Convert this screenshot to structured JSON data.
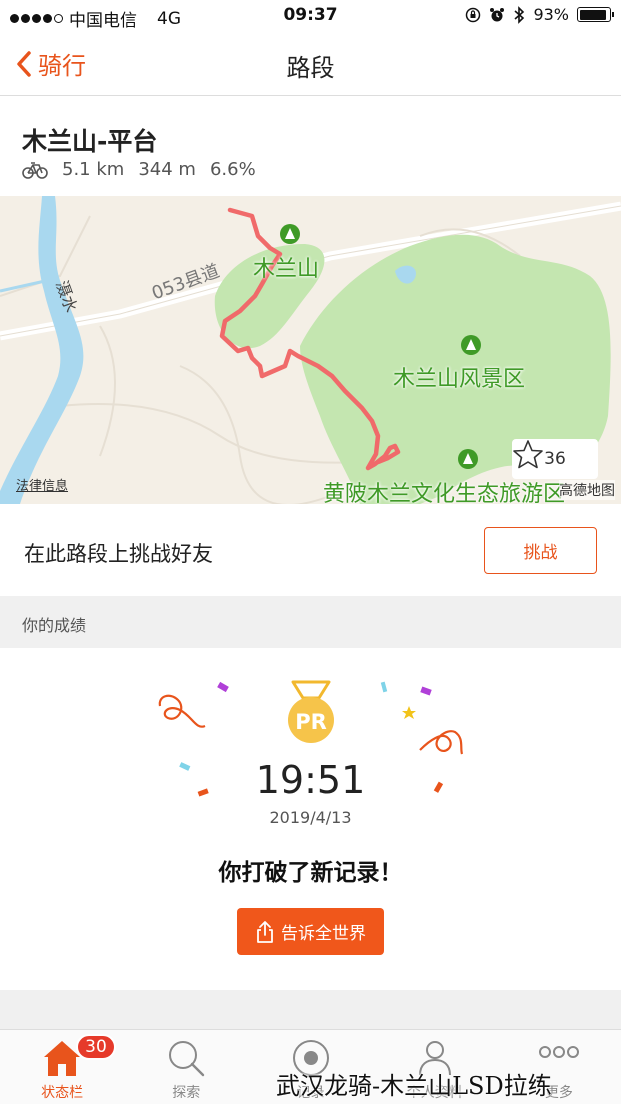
{
  "status_bar": {
    "carrier": "中国电信",
    "network": "4G",
    "time": "09:37",
    "battery": "93%",
    "battery_level": 0.93
  },
  "nav": {
    "back_label": "骑行",
    "title": "路段"
  },
  "segment": {
    "name": "木兰山-平台",
    "distance": "5.1 km",
    "elevation": "344 m",
    "grade": "6.6%",
    "activity_icon": "bike-icon"
  },
  "map": {
    "labels": {
      "mountain": "木兰山",
      "scenic_area": "木兰山风景区",
      "culture_area": "黄陂木兰文化生态旅游区",
      "road": "053县道",
      "river": "滠水",
      "legal": "法律信息",
      "provider": "高德地图"
    },
    "star_count": "36",
    "colors": {
      "route": "#f06a6a",
      "park": "#c4e6b0",
      "water": "#a9d8ef",
      "land": "#f4efe6"
    }
  },
  "challenge": {
    "text": "在此路段上挑战好友",
    "button_label": "挑战"
  },
  "results": {
    "section_title": "你的成绩",
    "badge": "PR",
    "time": "19:51",
    "date": "2019/4/13",
    "message": "你打破了新记录！",
    "share_label": "告诉全世界"
  },
  "tabs": [
    {
      "label": "状态栏",
      "icon": "home-icon",
      "badge": "30",
      "active": true
    },
    {
      "label": "探索",
      "icon": "search-icon"
    },
    {
      "label": "记录",
      "icon": "record-icon"
    },
    {
      "label": "个人资料",
      "icon": "profile-icon"
    },
    {
      "label": "更多",
      "icon": "more-icon"
    }
  ],
  "watermark": "武汉龙骑-木兰山LSD拉练",
  "accent_color": "#e8541c"
}
